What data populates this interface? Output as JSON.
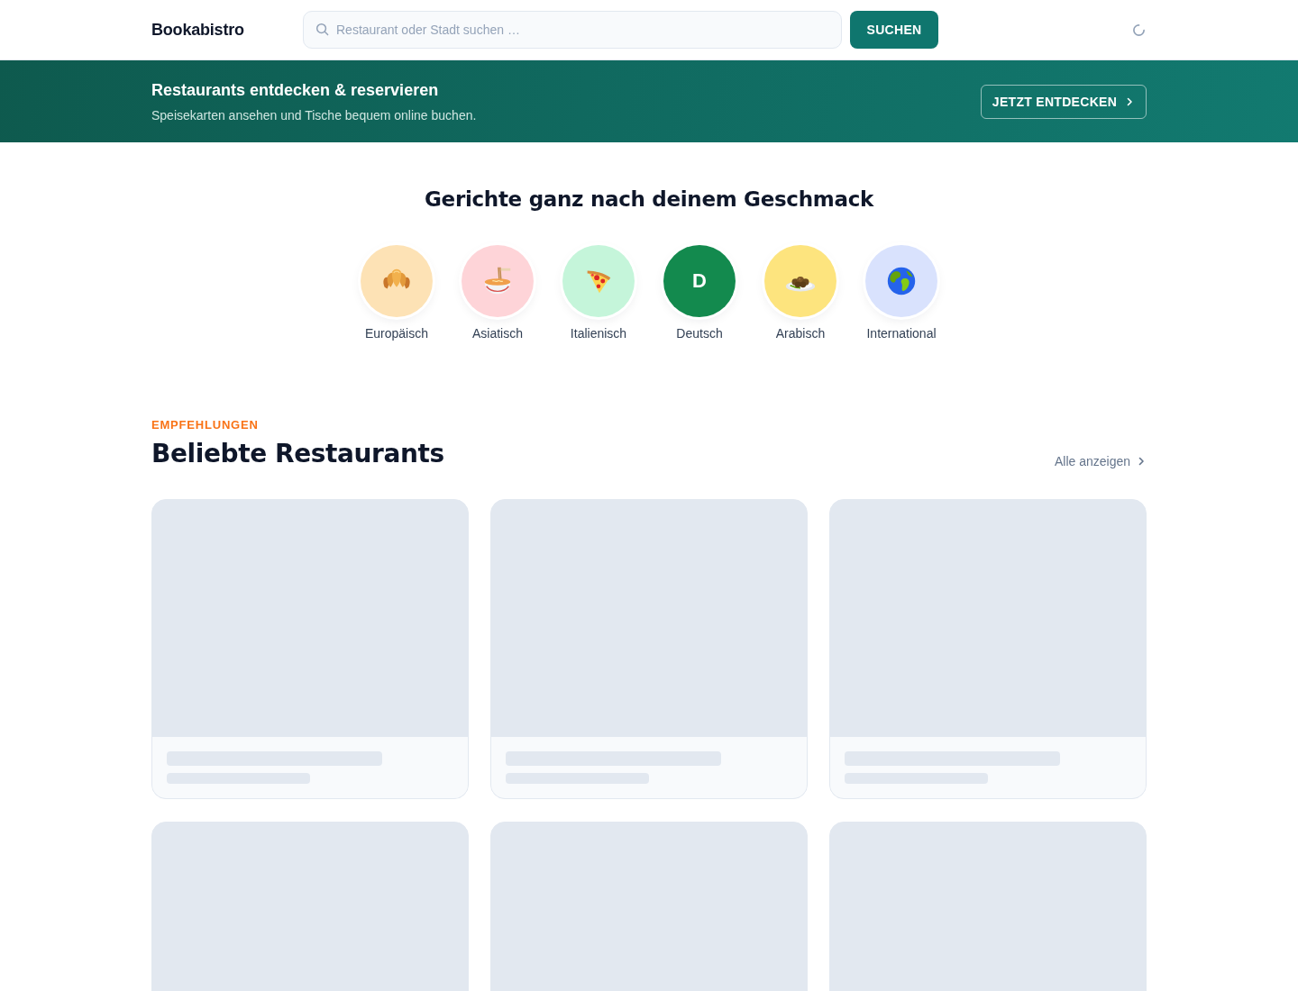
{
  "header": {
    "logo": "Bookabistro",
    "search": {
      "placeholder": "Restaurant oder Stadt suchen …"
    },
    "search_button": "SUCHEN",
    "loading": true
  },
  "banner": {
    "title": "Restaurants entdecken & reservieren",
    "subtitle": "Speisekarten ansehen und Tische bequem online buchen.",
    "button": "JETZT ENTDECKEN"
  },
  "categories": {
    "title": "Gerichte ganz nach deinem Geschmack",
    "items": [
      {
        "label": "Europäisch",
        "kind": "icon",
        "color": "#fde2b5"
      },
      {
        "label": "Asiatisch",
        "kind": "icon",
        "color": "#fed4d8"
      },
      {
        "label": "Italienisch",
        "kind": "icon",
        "color": "#c5f5da"
      },
      {
        "label": "Deutsch",
        "kind": "letter",
        "letter": "D",
        "color": "#138a4e"
      },
      {
        "label": "Arabisch",
        "kind": "icon",
        "color": "#fde47e"
      },
      {
        "label": "International",
        "kind": "icon",
        "color": "#d9e2fd"
      }
    ]
  },
  "recommendations": {
    "eyebrow": "EMPFEHLUNGEN",
    "title": "Beliebte Restaurants",
    "link": "Alle anzeigen",
    "cards": [
      {
        "kind": "skeleton"
      },
      {
        "kind": "skeleton"
      },
      {
        "kind": "skeleton"
      },
      {
        "kind": "skeleton"
      },
      {
        "kind": "skeleton"
      },
      {
        "kind": "skeleton"
      }
    ]
  }
}
